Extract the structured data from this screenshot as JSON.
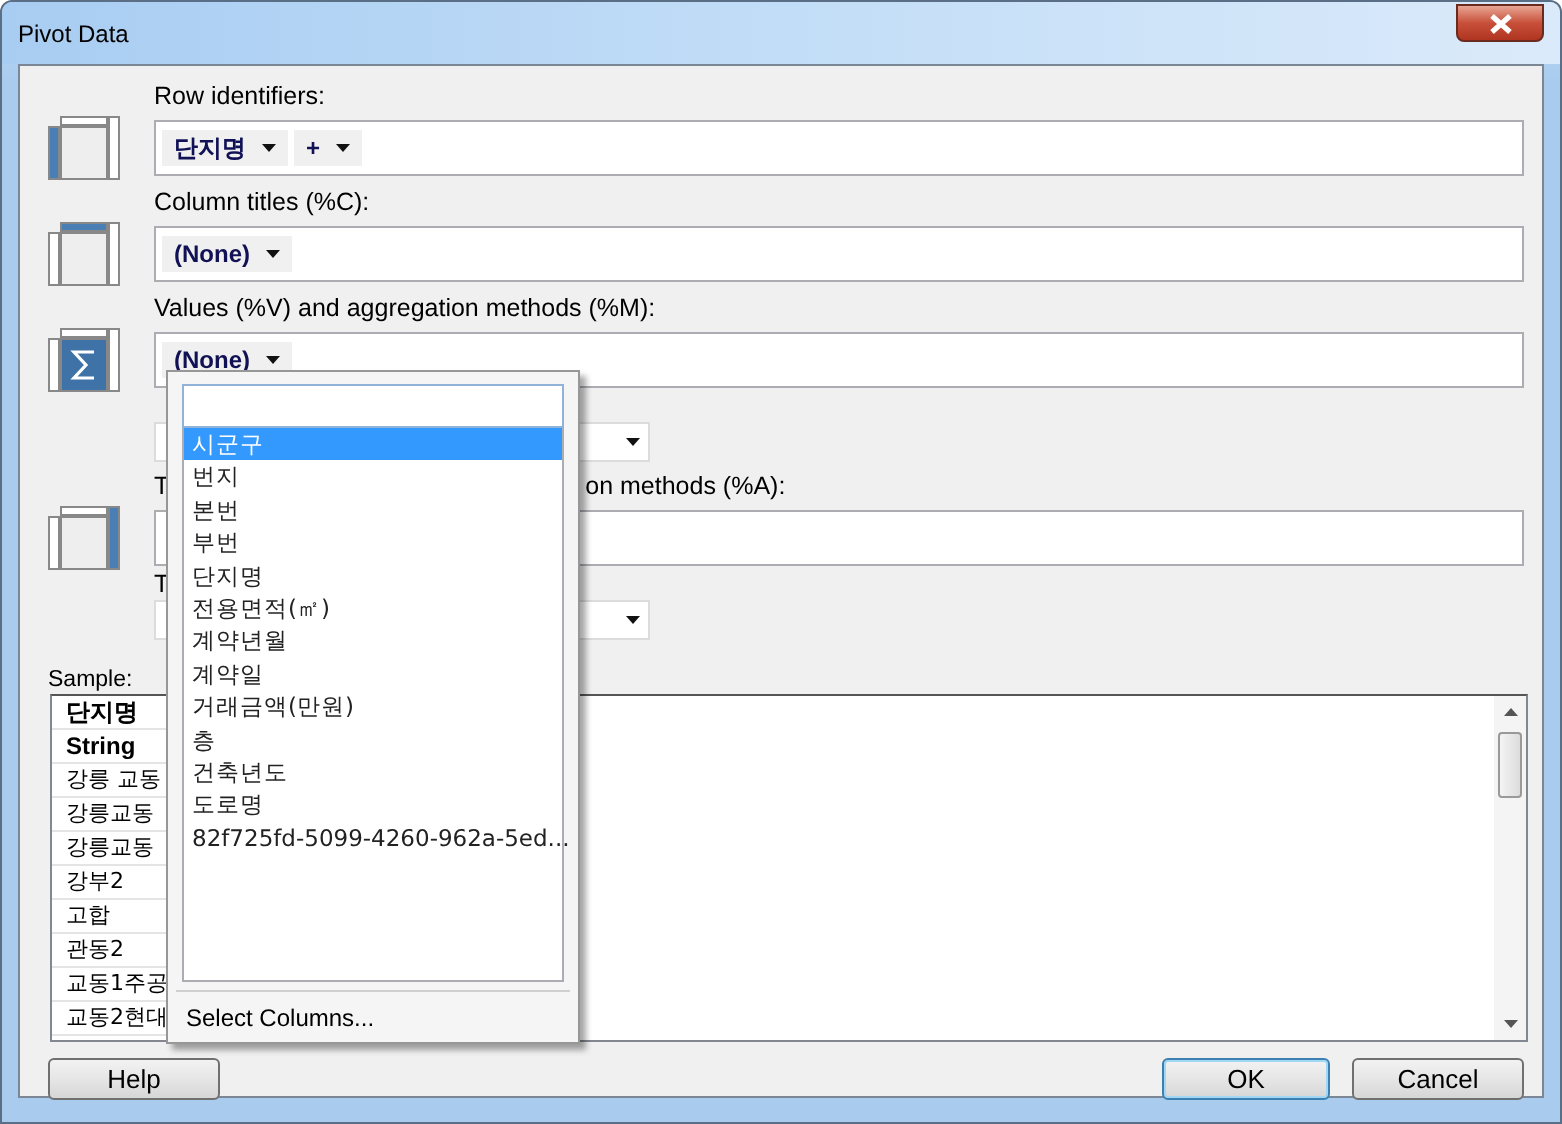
{
  "window": {
    "title": "Pivot Data"
  },
  "sections": [
    {
      "kind": "chips",
      "label": "Row identifiers:",
      "chips": [
        "단지명",
        "+"
      ]
    },
    {
      "kind": "chips",
      "label": "Column titles (%C):",
      "chips": [
        "(None)"
      ]
    },
    {
      "kind": "chips",
      "label": "Values (%V) and aggregation methods (%M):",
      "chips": [
        "(None)"
      ]
    },
    {
      "kind": "select"
    },
    {
      "kind": "field",
      "label_start": "T",
      "label_end": "on methods (%A):"
    },
    {
      "kind": "select",
      "label_start": "T"
    }
  ],
  "sample": {
    "label": "Sample:",
    "header": "단지명",
    "type": "String",
    "rows": [
      "강릉 교동",
      "강릉교동",
      "강릉교동",
      "강부2",
      "고합",
      "관동2",
      "교동1주공",
      "교동2현대"
    ]
  },
  "buttons": [
    {
      "kind": "help",
      "label": "Help",
      "focused": false
    },
    {
      "kind": "ok",
      "label": "OK",
      "focused": true
    },
    {
      "kind": "cancel",
      "label": "Cancel",
      "focused": false
    }
  ],
  "dropdown": {
    "items": [
      {
        "label": "시군구",
        "selected": true
      },
      {
        "label": "번지",
        "selected": false
      },
      {
        "label": "본번",
        "selected": false
      },
      {
        "label": "부번",
        "selected": false
      },
      {
        "label": "단지명",
        "selected": false
      },
      {
        "label": "전용면적(㎡)",
        "selected": false
      },
      {
        "label": "계약년월",
        "selected": false
      },
      {
        "label": "계약일",
        "selected": false
      },
      {
        "label": "거래금액(만원)",
        "selected": false
      },
      {
        "label": "층",
        "selected": false
      },
      {
        "label": "건축년도",
        "selected": false
      },
      {
        "label": "도로명",
        "selected": false
      },
      {
        "label": "82f725fd-5099-4260-962a-5ed...",
        "selected": false
      }
    ],
    "footer": "Select Columns..."
  }
}
